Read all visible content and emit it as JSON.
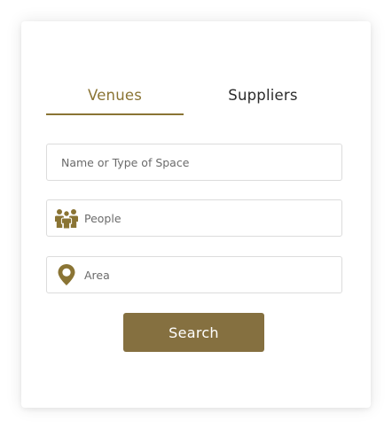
{
  "tabs": [
    {
      "label": "Venues",
      "active": true
    },
    {
      "label": "Suppliers",
      "active": false
    }
  ],
  "fields": {
    "name": {
      "placeholder": "Name or Type of Space",
      "value": ""
    },
    "people": {
      "placeholder": "People",
      "value": "",
      "icon": "people-icon"
    },
    "area": {
      "placeholder": "Area",
      "value": "",
      "icon": "location-pin-icon"
    }
  },
  "search_button": {
    "label": "Search"
  },
  "colors": {
    "accent": "#8a7434",
    "button": "#857040",
    "text": "#2b2b2b",
    "border": "#dcdcdc"
  }
}
